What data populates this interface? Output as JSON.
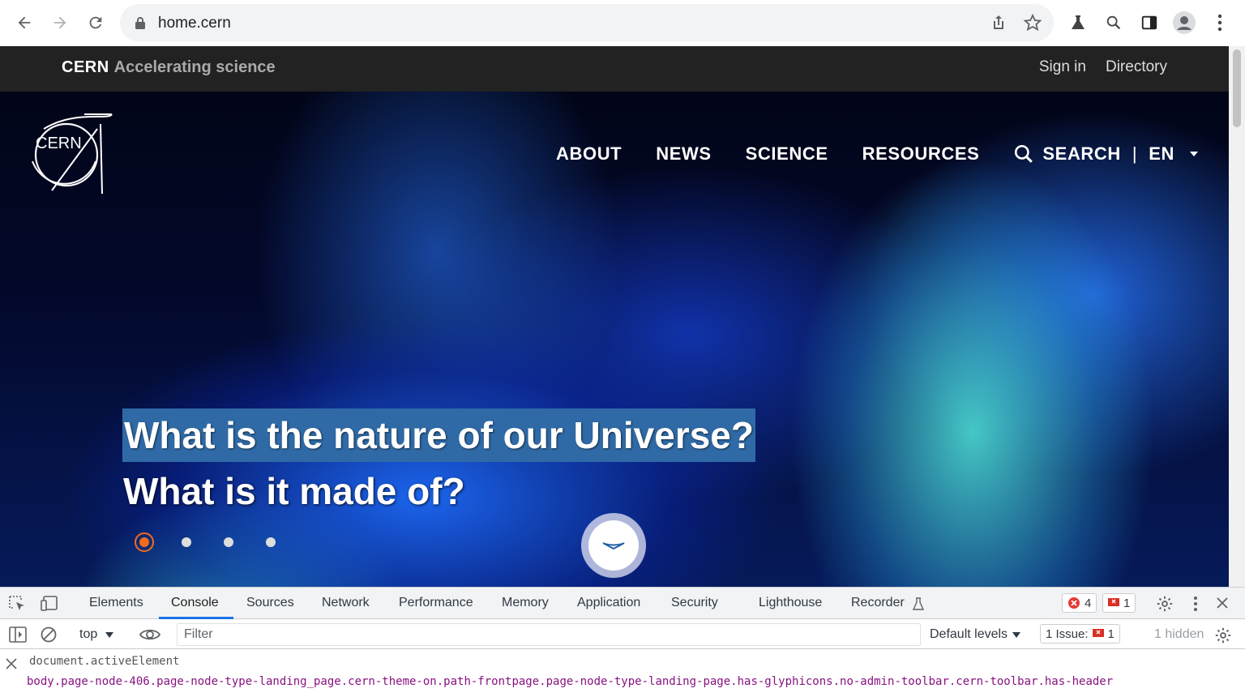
{
  "browser": {
    "url": "home.cern"
  },
  "site": {
    "brand": "CERN",
    "tagline": "Accelerating science",
    "top_links": [
      "Sign in",
      "Directory"
    ],
    "logo_text": "CERN",
    "nav": [
      "ABOUT",
      "NEWS",
      "SCIENCE",
      "RESOURCES"
    ],
    "search_label": "SEARCH",
    "separator": "|",
    "language": "EN",
    "headline_1": "What is the nature of our Universe?",
    "headline_2": "What is it made of?",
    "slide_count": 4,
    "active_slide": 1
  },
  "devtools": {
    "tabs": [
      "Elements",
      "Console",
      "Sources",
      "Network",
      "Performance",
      "Memory",
      "Application",
      "Security",
      "Lighthouse",
      "Recorder"
    ],
    "active_tab": "Console",
    "error_count": "4",
    "issue_count": "1",
    "context": "top",
    "filter_placeholder": "Filter",
    "levels": "Default levels",
    "issues_label": "1 Issue:",
    "issues_value": "1",
    "hidden": "1 hidden",
    "command": "document.activeElement",
    "result": "body.page-node-406.page-node-type-landing_page.cern-theme-on.path-frontpage.page-node-type-landing-page.has-glyphicons.no-admin-toolbar.cern-toolbar.has-header"
  },
  "colors": {
    "accent": "#f26b1d",
    "headline_bg": "#2f6aa6",
    "devtools_active": "#1a73e8",
    "result_text": "#881280"
  }
}
